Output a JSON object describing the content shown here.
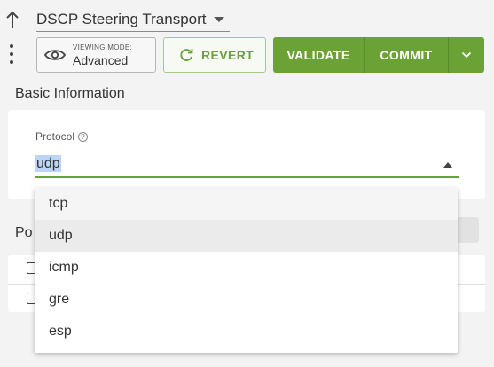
{
  "header": {
    "title": "DSCP Steering Transport"
  },
  "toolbar": {
    "viewing_mode_caption": "VIEWING MODE:",
    "viewing_mode_value": "Advanced",
    "revert_label": "REVERT",
    "validate_label": "VALIDATE",
    "commit_label": "COMMIT"
  },
  "colors": {
    "accent": "#6ba236",
    "selection_highlight": "#bcd4f5"
  },
  "section": {
    "title": "Basic Information"
  },
  "protocol_field": {
    "label": "Protocol",
    "value": "udp",
    "help_glyph": "?"
  },
  "background": {
    "partial_label": "Po"
  },
  "protocol_menu": {
    "items": [
      {
        "label": "tcp"
      },
      {
        "label": "udp"
      },
      {
        "label": "icmp"
      },
      {
        "label": "gre"
      },
      {
        "label": "esp"
      }
    ],
    "selected": "udp"
  }
}
